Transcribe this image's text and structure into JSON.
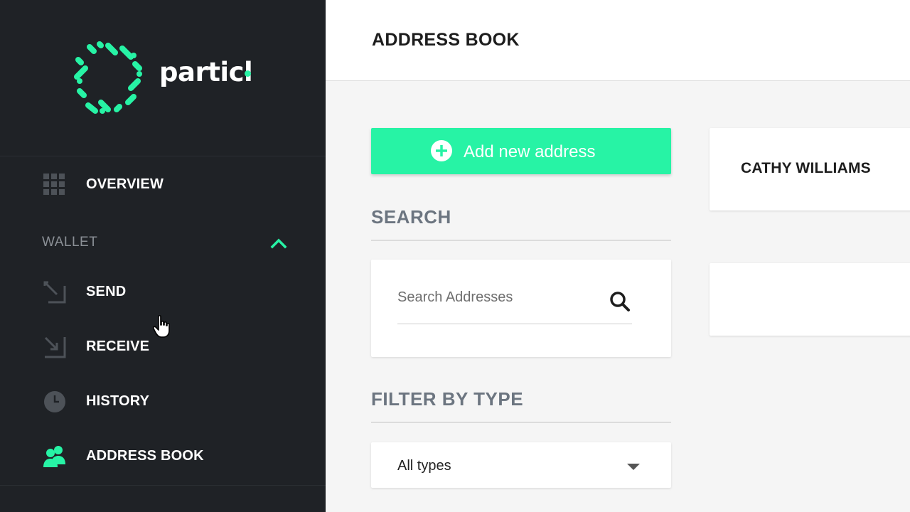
{
  "sidebar": {
    "brand": "particl",
    "nav": [
      {
        "id": "overview",
        "label": "OVERVIEW",
        "icon": "grid-icon"
      },
      {
        "id": "send",
        "label": "SEND",
        "icon": "send-arrow-icon"
      },
      {
        "id": "receive",
        "label": "RECEIVE",
        "icon": "receive-arrow-icon"
      },
      {
        "id": "history",
        "label": "HISTORY",
        "icon": "clock-icon"
      },
      {
        "id": "address_book",
        "label": "ADDRESS BOOK",
        "icon": "contacts-icon",
        "active": true
      }
    ],
    "wallet_section_label": "WALLET"
  },
  "header": {
    "title": "ADDRESS BOOK"
  },
  "main": {
    "add_button_label": "Add new address",
    "search_heading": "SEARCH",
    "search_placeholder": "Search Addresses",
    "filter_heading": "FILTER BY TYPE",
    "filter_selected": "All types",
    "contacts": [
      {
        "name": "CATHY WILLIAMS"
      }
    ]
  },
  "colors": {
    "accent": "#27f3a5",
    "sidebar_bg": "#1f2226",
    "content_bg": "#f5f5f5"
  }
}
